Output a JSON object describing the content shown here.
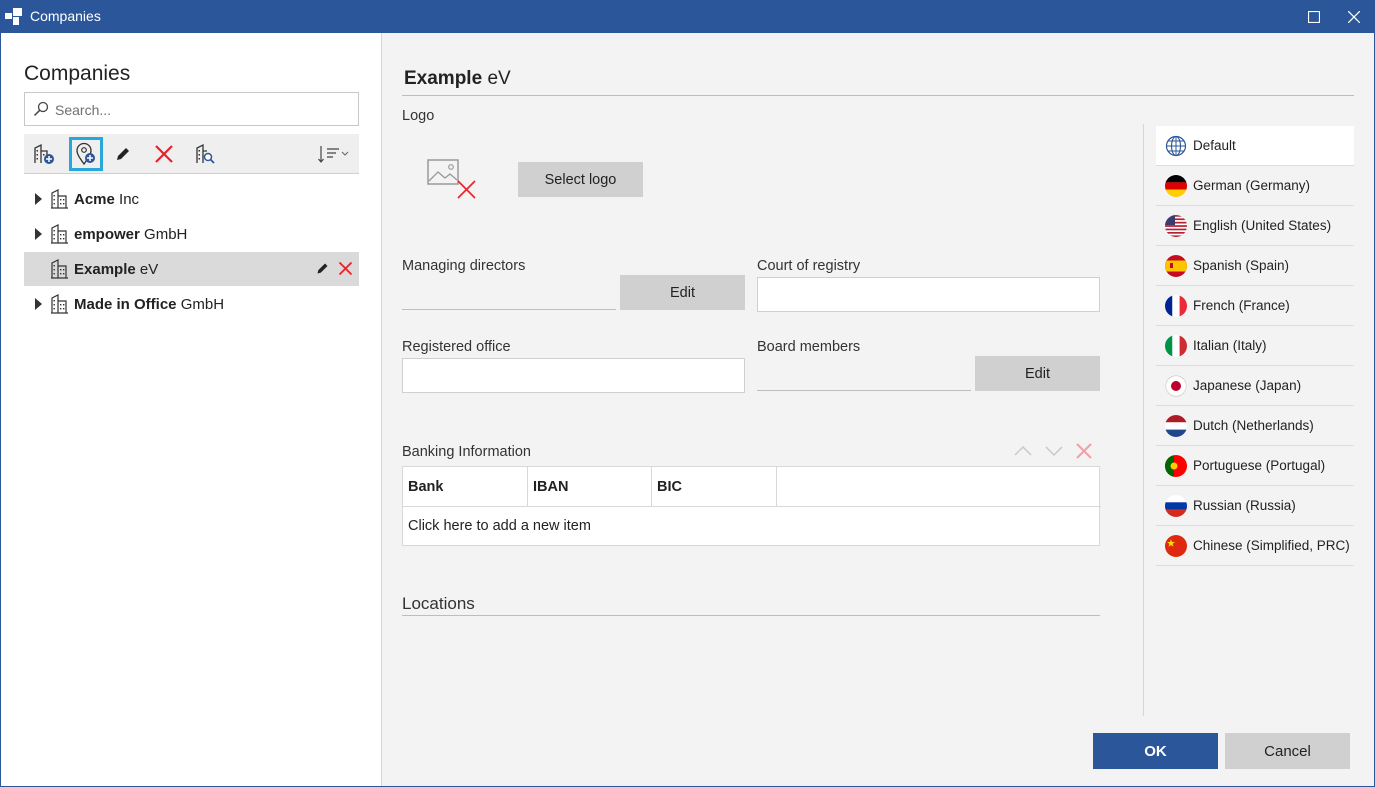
{
  "window": {
    "title": "Companies"
  },
  "sidebar": {
    "title": "Companies",
    "search": {
      "placeholder": "Search...",
      "value": ""
    },
    "toolbar": [
      {
        "icon": "add-company-icon"
      },
      {
        "icon": "add-location-icon",
        "active": true
      },
      {
        "icon": "edit-pencil-icon"
      },
      {
        "icon": "delete-x-icon"
      },
      {
        "icon": "search-company-icon"
      },
      {
        "icon": "sort-icon"
      }
    ],
    "companies": [
      {
        "bold": "Acme",
        "rest": "Inc",
        "expandable": true,
        "selected": false
      },
      {
        "bold": "empower",
        "rest": "GmbH",
        "expandable": true,
        "selected": false
      },
      {
        "bold": "Example",
        "rest": "eV",
        "expandable": false,
        "selected": true
      },
      {
        "bold": "Made in Office",
        "rest": "GmbH",
        "expandable": true,
        "selected": false
      }
    ]
  },
  "main": {
    "heading": {
      "bold": "Example",
      "rest": "eV"
    },
    "logo": {
      "label": "Logo",
      "button": "Select logo"
    },
    "managing_directors": {
      "label": "Managing directors",
      "button": "Edit",
      "value": ""
    },
    "court_of_registry": {
      "label": "Court of registry",
      "value": ""
    },
    "registered_office": {
      "label": "Registered office",
      "value": ""
    },
    "board_members": {
      "label": "Board members",
      "button": "Edit",
      "value": ""
    },
    "banking": {
      "label": "Banking Information",
      "columns": [
        "Bank",
        "IBAN",
        "BIC"
      ],
      "add_item": "Click here to add a new item"
    },
    "locations": {
      "label": "Locations"
    }
  },
  "languages": [
    {
      "label": "Default",
      "selected": true
    },
    {
      "label": "German (Germany)"
    },
    {
      "label": "English (United States)"
    },
    {
      "label": "Spanish (Spain)"
    },
    {
      "label": "French (France)"
    },
    {
      "label": "Italian (Italy)"
    },
    {
      "label": "Japanese (Japan)"
    },
    {
      "label": "Dutch (Netherlands)"
    },
    {
      "label": "Portuguese (Portugal)"
    },
    {
      "label": "Russian (Russia)"
    },
    {
      "label": "Chinese (Simplified, PRC)"
    }
  ],
  "dialog": {
    "ok": "OK",
    "cancel": "Cancel"
  },
  "colors": {
    "titlebar": "#2b579a",
    "ok_button": "#2b579a",
    "active_tool_border": "#29a7d8",
    "delete_red": "#e8202a"
  }
}
